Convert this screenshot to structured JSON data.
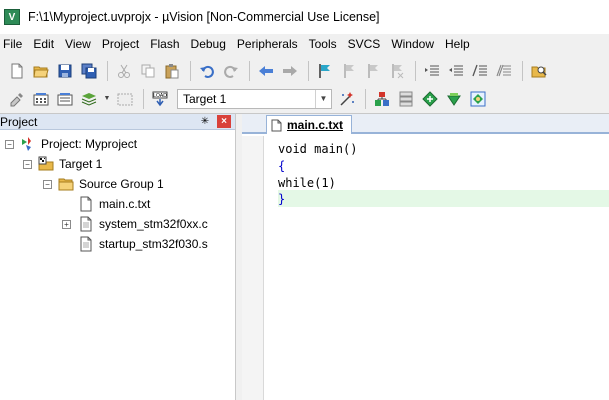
{
  "window": {
    "title": "F:\\1\\Myproject.uvprojx - µVision  [Non-Commercial Use License]",
    "app_icon_label": "V"
  },
  "menu": [
    "File",
    "Edit",
    "View",
    "Project",
    "Flash",
    "Debug",
    "Peripherals",
    "Tools",
    "SVCS",
    "Window",
    "Help"
  ],
  "toolbar2": {
    "target_select": {
      "value": "Target 1"
    }
  },
  "project_panel": {
    "title": "Project",
    "pin_glyph": "✳",
    "close_glyph": "×",
    "tree": {
      "root": "Project: Myproject",
      "target": "Target 1",
      "group": "Source Group 1",
      "files": [
        "main.c.txt",
        "system_stm32f0xx.c",
        "startup_stm32f030.s"
      ]
    }
  },
  "editor": {
    "tab_label": "main.c.txt",
    "lines": [
      "void main()",
      "{",
      "while(1)",
      "}"
    ],
    "highlight_line": 4,
    "colors": {
      "brace": "#0000cc",
      "current_line_bg": "#e4f8e6",
      "tab_border": "#98b3d8"
    }
  },
  "icons": {
    "toolbar1": [
      "new-file-icon",
      "open-folder-icon",
      "save-icon",
      "save-all-icon",
      "cut-icon",
      "copy-icon",
      "paste-icon",
      "undo-icon",
      "redo-icon",
      "navigate-back-icon",
      "navigate-forward-icon",
      "bookmark-icon",
      "prev-bookmark-icon",
      "next-bookmark-icon",
      "clear-bookmarks-icon",
      "indent-icon",
      "unindent-icon",
      "comment-icon",
      "uncomment-icon",
      "find-in-files-icon"
    ],
    "toolbar2": [
      "translate-icon",
      "build-icon",
      "rebuild-icon",
      "batch-build-icon",
      "stop-build-icon",
      "download-icon",
      "target-options-icon",
      "file-extensions-icon",
      "manage-run-time-icon",
      "select-packs-icon",
      "pack-installer-icon"
    ]
  }
}
